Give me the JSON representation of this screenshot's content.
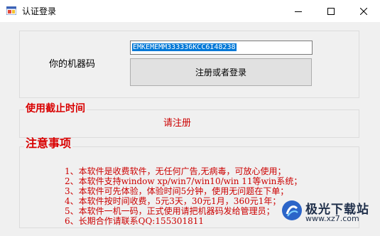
{
  "window": {
    "title": "认证登录"
  },
  "register": {
    "machine_label": "你的机器码",
    "machine_code": "EMKEMEMM333336KCC6I48238",
    "button_label": "注册或者登录"
  },
  "expiry": {
    "section_title": "使用截止时间",
    "status_text": "请注册"
  },
  "notices": {
    "section_title": "注意事项",
    "items": [
      "1、本软件是收费软件，无任何广告,无病毒，可放心使用；",
      "2、本软件支持window xp/win7/win10/win 11等win系统；",
      "3、本软件可先体验，体验时间5分钟，使用无问题在下单；",
      "4、本软件按时间收费，5元3天，30元1月，360元1年；",
      "5、本软件一机一码，正式使用请把机器码发给管理员；",
      "6、长期合作请联系QQ:155301811"
    ]
  },
  "watermark": {
    "name": "极光下载站",
    "url": "www.xz7.com"
  },
  "colors": {
    "accent_red": "#cc0000",
    "selection_blue": "#0078d7"
  }
}
